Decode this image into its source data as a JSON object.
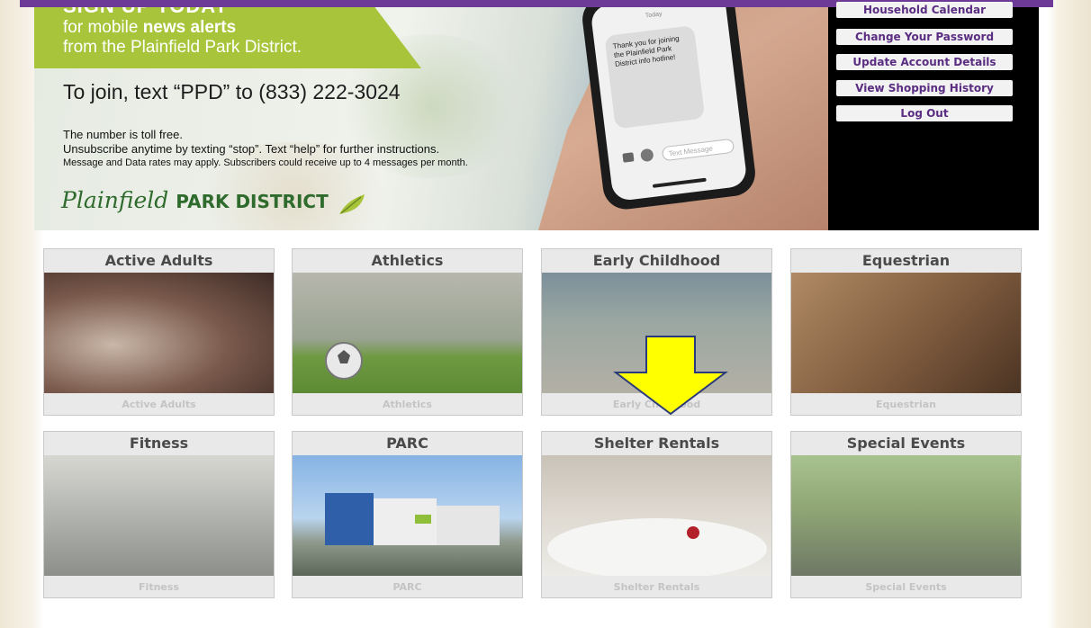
{
  "banner": {
    "cut_headline": "SIGN UP TODAY",
    "line1_prefix": "for mobile ",
    "line1_bold": "news alerts",
    "line2": "from the Plainfield Park District.",
    "join": "To join, text “PPD” to (833) 222-3024",
    "note1": "The number is toll free.",
    "note2": "Unsubscribe anytime by texting “stop”. Text “help” for further instructions.",
    "note3": "Message and Data rates may apply. Subscribers could receive up to 4 messages per month.",
    "logo_script": "Plainfield",
    "logo_bold": "PARK DISTRICT",
    "phone_today": "Today",
    "phone_message": "Thank you for joining the Plainfield Park District info hotline!",
    "phone_placeholder": "Text Message"
  },
  "account_menu": [
    {
      "label": "Household Calendar"
    },
    {
      "label": "Change Your Password"
    },
    {
      "label": "Update Account Details"
    },
    {
      "label": "View Shopping History"
    },
    {
      "label": "Log Out"
    }
  ],
  "categories": [
    {
      "title": "Active Adults",
      "caption": "Active Adults"
    },
    {
      "title": "Athletics",
      "caption": "Athletics"
    },
    {
      "title": "Early Childhood",
      "caption": "Early Childhood"
    },
    {
      "title": "Equestrian",
      "caption": "Equestrian"
    },
    {
      "title": "Fitness",
      "caption": "Fitness"
    },
    {
      "title": "PARC",
      "caption": "PARC"
    },
    {
      "title": "Shelter Rentals",
      "caption": "Shelter Rentals"
    },
    {
      "title": "Special Events",
      "caption": "Special Events"
    }
  ],
  "colors": {
    "brand_purple": "#6d3a97",
    "promo_green": "#a8c43a",
    "logo_green": "#2e6b2c",
    "arrow_yellow": "#ffff00"
  }
}
